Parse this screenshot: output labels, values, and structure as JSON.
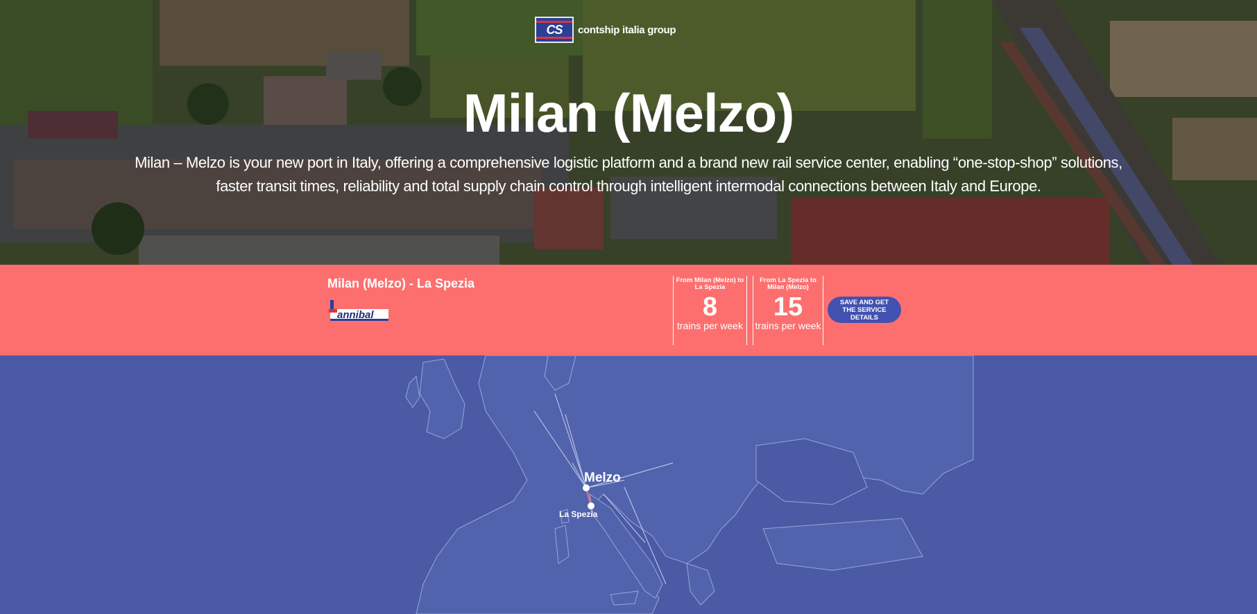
{
  "hero": {
    "logo_mark": "CS",
    "logo_text": "contship italia group",
    "title": "Milan (Melzo)",
    "description": "Milan – Melzo is your new port in Italy, offering a comprehensive logistic platform and a brand new rail service center, enabling “one-stop-shop” solutions, faster transit times, reliability and total supply chain control through intelligent intermodal connections between Italy and Europe."
  },
  "service": {
    "route": "Milan (Melzo) - La Spezia",
    "operator_logo": "hannibal",
    "stats": [
      {
        "heading": "From Milan (Melzo) to La Spezia",
        "value": "8",
        "unit": "trains per week"
      },
      {
        "heading": "From La Spezia to Milan (Melzo)",
        "value": "15",
        "unit": "trains per week"
      }
    ],
    "cta_label": "SAVE AND GET THE SERVICE DETAILS"
  },
  "map": {
    "origin_label": "Melzo",
    "destination_label": "La Spezia"
  },
  "colors": {
    "band": "#fd6f6f",
    "map_sea": "#4a5aa5",
    "cta": "#4251b0"
  }
}
